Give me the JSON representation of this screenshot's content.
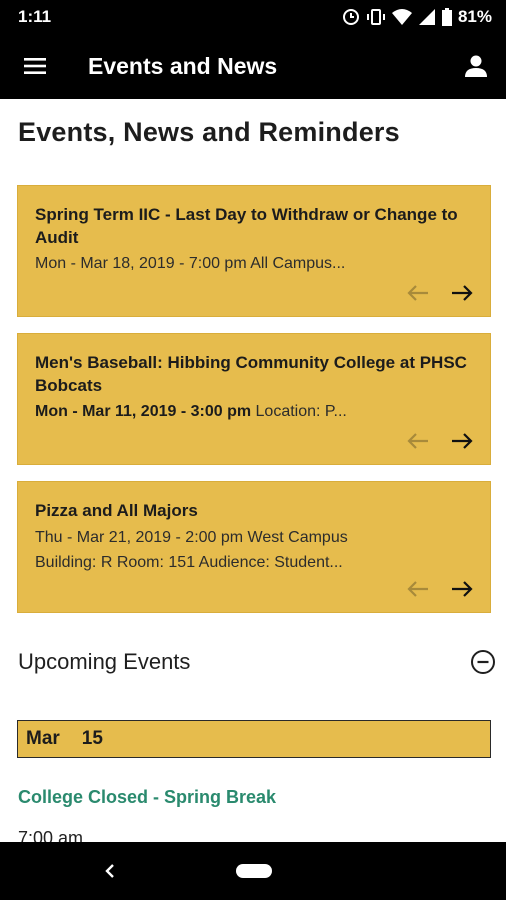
{
  "status_bar": {
    "time": "1:11",
    "battery": "81%"
  },
  "app_bar": {
    "title": "Events and News"
  },
  "page": {
    "heading": "Events, News and Reminders"
  },
  "cards": [
    {
      "title": "Spring Term IIC - Last Day to Withdraw or Change to Audit",
      "line1": "Mon - Mar 18, 2019 - 7:00 pm All Campus...",
      "line2_bold": "",
      "line2": ""
    },
    {
      "title": "Men's Baseball: Hibbing Community College at PHSC Bobcats",
      "line1_bold": "Mon - Mar 11, 2019 - 3:00 pm",
      "line1": " Location: P..."
    },
    {
      "title": "Pizza and All Majors",
      "line1": "Thu - Mar 21, 2019 - 2:00 pm West Campus",
      "line2": "Building: R Room: 151 Audience: Student..."
    }
  ],
  "upcoming": {
    "title": "Upcoming Events"
  },
  "date_bar": {
    "month": "Mar",
    "day": "15"
  },
  "event": {
    "title": "College Closed - Spring Break",
    "time": "7:00 am"
  },
  "colors": {
    "card": "#e6bc4d",
    "event_title": "#2a8a6e",
    "bars": "#000000"
  },
  "icons": {
    "menu": "hamburger-icon",
    "profile": "person-icon",
    "prev": "arrow-left-icon",
    "next": "arrow-right-icon",
    "collapse": "minus-circle-icon",
    "back": "chevron-left-icon"
  }
}
